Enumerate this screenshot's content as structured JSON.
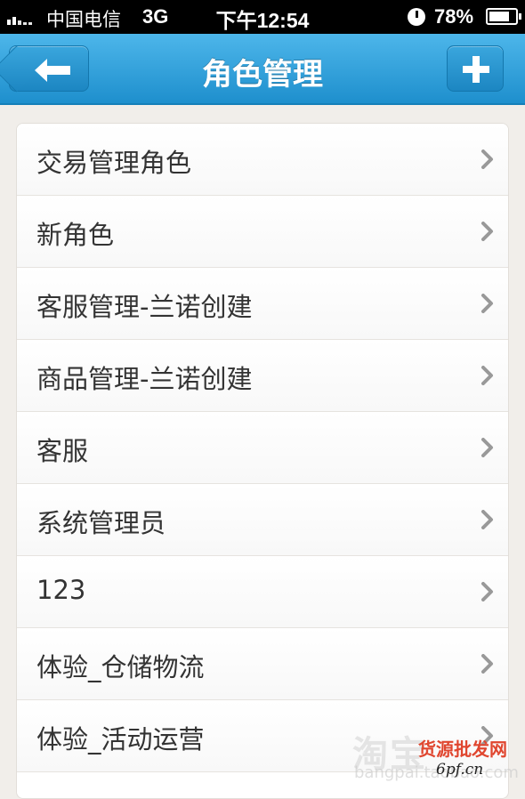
{
  "status_bar": {
    "carrier": "中国电信",
    "network": "3G",
    "time": "下午12:54",
    "battery": "78%",
    "battery_level": 0.78
  },
  "navbar": {
    "title": "角色管理",
    "back_icon": "arrow-left-icon",
    "add_icon": "plus-icon"
  },
  "roles": [
    {
      "label": "交易管理角色"
    },
    {
      "label": "新角色"
    },
    {
      "label": "客服管理-兰诺创建"
    },
    {
      "label": "商品管理-兰诺创建"
    },
    {
      "label": "客服"
    },
    {
      "label": "系统管理员"
    },
    {
      "label": "123"
    },
    {
      "label": "体验_仓储物流"
    },
    {
      "label": "体验_活动运营"
    }
  ],
  "watermark": {
    "brand": "淘宝",
    "domain": "bangpai.taobao.com",
    "logo_text": "货源批发网",
    "logo_url": "6pf.cn"
  },
  "colors": {
    "navbar": "#1e8fcd",
    "background": "#f1eeea",
    "text": "#333333",
    "chevron": "#999999"
  }
}
